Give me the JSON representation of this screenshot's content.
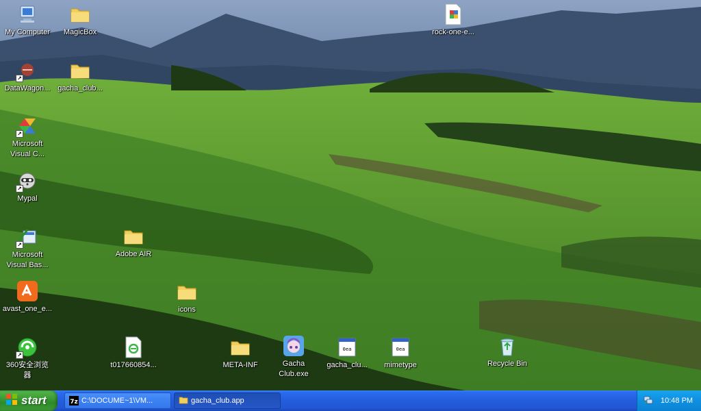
{
  "desktop_icons": {
    "my_computer": "My Computer",
    "magicbox": "MagicBox",
    "rock_one": "rock-one-e...",
    "datawagon": "DataWagon...",
    "gacha_club_folder": "gacha_club...",
    "ms_visual_c": "Microsoft\nVisual C...",
    "mypal": "Mypal",
    "ms_visual_basic": "Microsoft\nVisual Bas...",
    "adobe_air": "Adobe AIR",
    "avast": "avast_one_e...",
    "icons": "icons",
    "browser_360": "360安全浏览\n器",
    "t0176": "t017660854...",
    "meta_inf": "META-INF",
    "gacha_club_exe": "Gacha\nClub.exe",
    "gacha_clu_file": "gacha_clu...",
    "mimetype": "mimetype",
    "recycle_bin": "Recycle Bin"
  },
  "taskbar": {
    "start_label": "start",
    "tasks": [
      {
        "label": "C:\\DOCUME~1\\VM..."
      },
      {
        "label": "gacha_club.app"
      }
    ],
    "clock": "10:48 PM"
  },
  "colors": {
    "taskbar_blue": "#245ddb",
    "start_green": "#3a9a34",
    "tray_blue": "#0f8fe0"
  }
}
